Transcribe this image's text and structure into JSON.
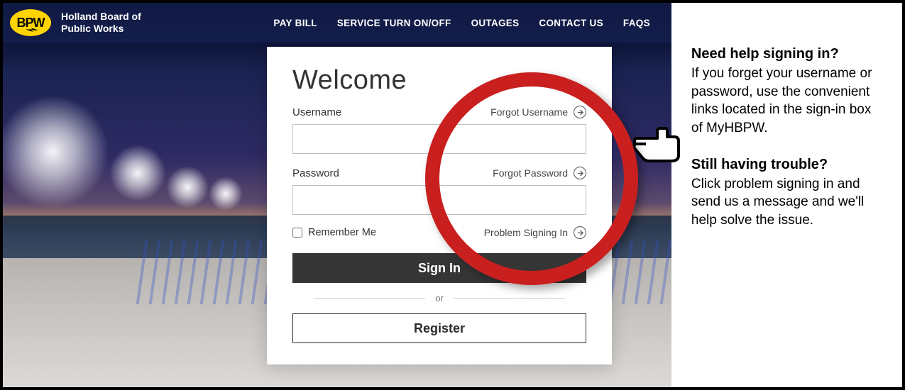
{
  "header": {
    "logo_text": "BPW",
    "org_name_line1": "Holland Board of",
    "org_name_line2": "Public Works",
    "nav": {
      "pay_bill": "PAY BILL",
      "service": "SERVICE TURN ON/OFF",
      "outages": "OUTAGES",
      "contact": "CONTACT US",
      "faqs": "FAQS"
    }
  },
  "login": {
    "title": "Welcome",
    "username_label": "Username",
    "forgot_username": "Forgot Username",
    "password_label": "Password",
    "forgot_password": "Forgot Password",
    "remember_me": "Remember Me",
    "problem_signing_in": "Problem Signing In",
    "sign_in": "Sign In",
    "or": "or",
    "register": "Register",
    "username_value": "",
    "password_value": ""
  },
  "help": {
    "h1": "Need help signing in?",
    "p1": "If you forget your username or password, use the convenient links located in the sign-in box of MyHBPW.",
    "h2": "Still having trouble?",
    "p2": "Click problem signing in and send us a message and we'll help solve the issue."
  },
  "colors": {
    "accent_yellow": "#ffd400",
    "header_bg": "#131d4a",
    "highlight_red": "#c91f1f",
    "button_dark": "#353535"
  }
}
